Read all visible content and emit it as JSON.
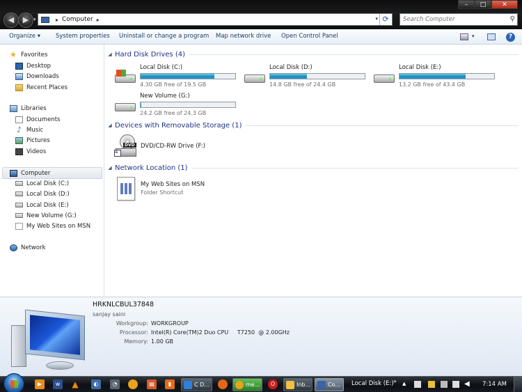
{
  "window": {
    "breadcrumb": "Computer",
    "search_placeholder": "Search Computer",
    "controls": {
      "minimize": "–",
      "maximize": "□",
      "close": "✕"
    }
  },
  "toolbar": {
    "organize": "Organize ▾",
    "system_properties": "System properties",
    "uninstall": "Uninstall or change a program",
    "map_network_drive": "Map network drive",
    "open_control_panel": "Open Control Panel",
    "help": "?"
  },
  "sidebar": {
    "favorites": "Favorites",
    "desktop": "Desktop",
    "downloads": "Downloads",
    "recent_places": "Recent Places",
    "libraries": "Libraries",
    "documents": "Documents",
    "music": "Music",
    "pictures": "Pictures",
    "videos": "Videos",
    "computer": "Computer",
    "drives": [
      "Local Disk (C:)",
      "Local Disk (D:)",
      "Local Disk (E:)",
      "New Volume (G:)",
      "My Web Sites on MSN"
    ],
    "network": "Network"
  },
  "groups": {
    "hdd_title": "Hard Disk Drives (4)",
    "removable_title": "Devices with Removable Storage (1)",
    "network_title": "Network Location (1)"
  },
  "drives": [
    {
      "name": "Local Disk (C:)",
      "free": "4.30 GB free of 19.5 GB",
      "used_fraction": 0.78
    },
    {
      "name": "Local Disk (D:)",
      "free": "14.8 GB free of 24.4 GB",
      "used_fraction": 0.39
    },
    {
      "name": "Local Disk (E:)",
      "free": "13.2 GB free of 43.4 GB",
      "used_fraction": 0.7
    },
    {
      "name": "New Volume (G:)",
      "free": "24.2 GB free of 24.3 GB",
      "used_fraction": 0.004
    }
  ],
  "removable": {
    "name": "DVD/CD-RW Drive (F:)",
    "badge": "DVD"
  },
  "network_location": {
    "name": "My Web Sites on MSN",
    "sub": "Folder Shortcut"
  },
  "details": {
    "computer_name": "HRKNLCBUL37848",
    "user": "sanjay saini",
    "workgroup_label": "Workgroup:",
    "workgroup": "WORKGROUP",
    "processor_label": "Processor:",
    "processor": "Intel(R) Core(TM)2 Duo CPU     T7250  @ 2.00GHz",
    "memory_label": "Memory:",
    "memory": "1.00 GB"
  },
  "taskbar": {
    "tasks": [
      "C D...",
      "me...",
      "Inb...",
      "Co..."
    ],
    "address": "Local Disk (E:)",
    "chevron": "»",
    "clock": "7:14 AM"
  }
}
